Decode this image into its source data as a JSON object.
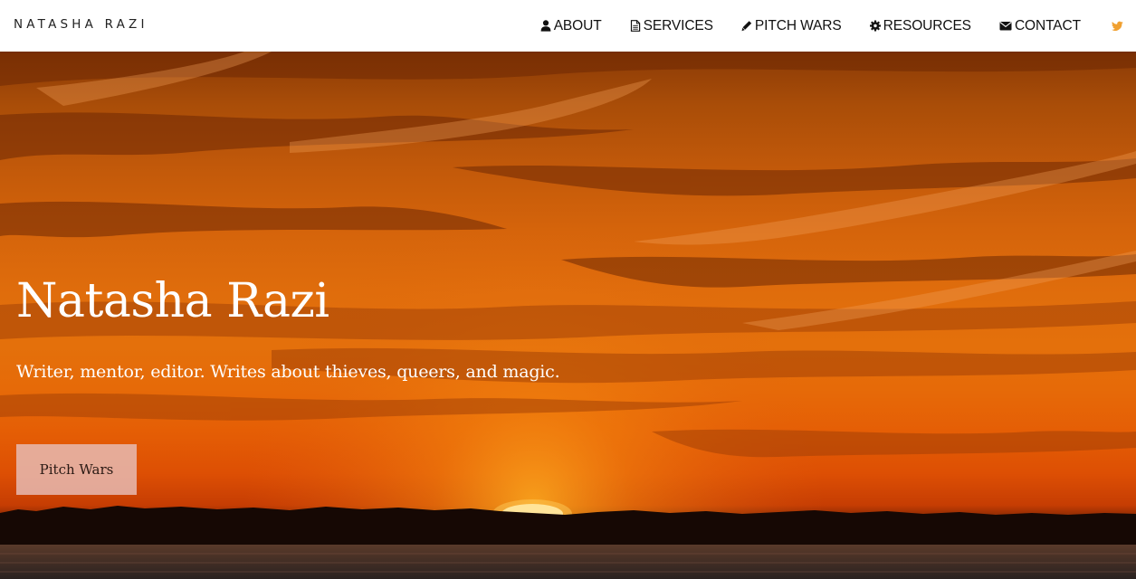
{
  "site": {
    "brand": "NATASHA RAZI"
  },
  "nav": {
    "items": [
      {
        "label": "ABOUT",
        "icon": "user-icon"
      },
      {
        "label": "SERVICES",
        "icon": "document-icon"
      },
      {
        "label": "PITCH WARS",
        "icon": "pencil-icon"
      },
      {
        "label": "RESOURCES",
        "icon": "gear-icon"
      },
      {
        "label": "CONTACT",
        "icon": "envelope-icon"
      }
    ],
    "twitter_icon": "twitter-icon",
    "twitter_color": "#f0a030"
  },
  "hero": {
    "title": "Natasha Razi",
    "subtitle": "Writer, mentor, editor. Writes about thieves, queers, and magic.",
    "button_label": "Pitch Wars",
    "background": "sunset-over-water-photo"
  }
}
